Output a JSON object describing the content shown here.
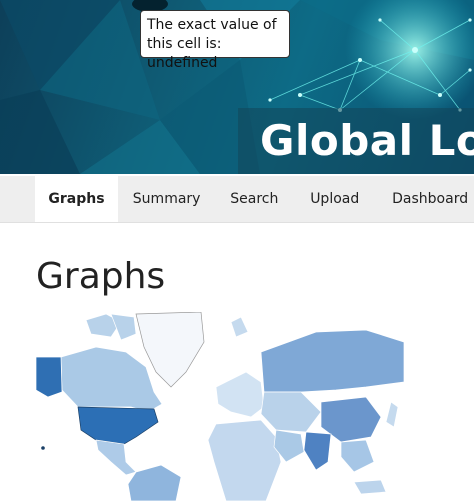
{
  "banner": {
    "title": "Global Logi"
  },
  "tooltip": {
    "text": "The exact value of this cell is: undefined"
  },
  "tabs": [
    {
      "label": "Graphs",
      "active": true
    },
    {
      "label": "Summary",
      "active": false
    },
    {
      "label": "Search",
      "active": false
    },
    {
      "label": "Upload",
      "active": false
    },
    {
      "label": "Dashboard",
      "active": false
    }
  ],
  "main": {
    "heading": "Graphs"
  },
  "colors": {
    "accent": "#0f5b74",
    "map_dark": "#2c6fb5",
    "map_mid": "#7fa8d6",
    "map_light": "#c5daee",
    "map_pale": "#eef3fa"
  }
}
